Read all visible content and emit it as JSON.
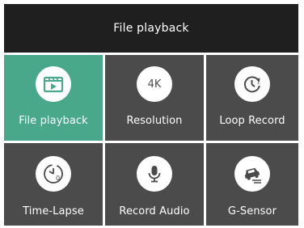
{
  "header": {
    "title": "File playback"
  },
  "menu": [
    {
      "label": "File playback",
      "icon": "play-video-icon",
      "active": true
    },
    {
      "label": "Resolution",
      "icon": "resolution-4k-icon",
      "icon_text": "4K",
      "active": false
    },
    {
      "label": "Loop Record",
      "icon": "loop-record-icon",
      "active": false
    },
    {
      "label": "Time-Lapse",
      "icon": "time-lapse-icon",
      "icon_text": "0",
      "active": false
    },
    {
      "label": "Record Audio",
      "icon": "microphone-icon",
      "active": false
    },
    {
      "label": "G-Sensor",
      "icon": "g-sensor-car-icon",
      "active": false
    }
  ],
  "colors": {
    "header_bg": "#1f1f1f",
    "tile_bg": "#4b4b4b",
    "active_tile_bg": "#4aa88a",
    "icon_circle": "#ffffff"
  }
}
